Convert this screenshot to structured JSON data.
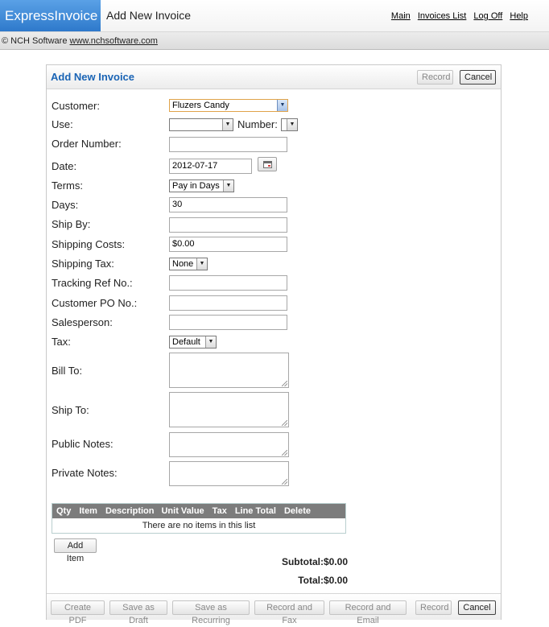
{
  "app": {
    "brand": "ExpressInvoice",
    "page_title": "Add New Invoice"
  },
  "topnav": {
    "items": [
      "Main",
      "Invoices List",
      "Log Off",
      "Help"
    ]
  },
  "copyright": {
    "text": "© NCH Software ",
    "link": "www.nchsoftware.com"
  },
  "panel": {
    "title": "Add New Invoice",
    "record_label": "Record",
    "cancel_label": "Cancel"
  },
  "form": {
    "customer": {
      "label": "Customer:",
      "value": "Fluzers Candy"
    },
    "use": {
      "label": "Use:",
      "value": ""
    },
    "number": {
      "label": "Number:",
      "value": ""
    },
    "order_number": {
      "label": "Order Number:",
      "value": ""
    },
    "date": {
      "label": "Date:",
      "value": "2012-07-17"
    },
    "terms": {
      "label": "Terms:",
      "value": "Pay in Days"
    },
    "days": {
      "label": "Days:",
      "value": "30"
    },
    "ship_by": {
      "label": "Ship By:",
      "value": ""
    },
    "shipping_costs": {
      "label": "Shipping Costs:",
      "value": "$0.00"
    },
    "shipping_tax": {
      "label": "Shipping Tax:",
      "value": "None"
    },
    "tracking_ref": {
      "label": "Tracking Ref No.:",
      "value": ""
    },
    "customer_po": {
      "label": "Customer PO No.:",
      "value": ""
    },
    "salesperson": {
      "label": "Salesperson:",
      "value": ""
    },
    "tax": {
      "label": "Tax:",
      "value": "Default"
    },
    "bill_to": {
      "label": "Bill To:",
      "value": ""
    },
    "ship_to": {
      "label": "Ship To:",
      "value": ""
    },
    "public_notes": {
      "label": "Public Notes:",
      "value": ""
    },
    "private_notes": {
      "label": "Private Notes:",
      "value": ""
    }
  },
  "items_table": {
    "columns": [
      "Qty",
      "Item",
      "Description",
      "Unit Value",
      "Tax",
      "Line Total",
      "Delete"
    ],
    "empty_text": "There are no items in this list",
    "add_label": "Add Item"
  },
  "totals": {
    "subtotal": "Subtotal:$0.00",
    "total": "Total:$0.00"
  },
  "footer": {
    "buttons": [
      "Create PDF",
      "Save as Draft",
      "Save as Recurring",
      "Record and Fax",
      "Record and Email",
      "Record",
      "Cancel"
    ]
  }
}
